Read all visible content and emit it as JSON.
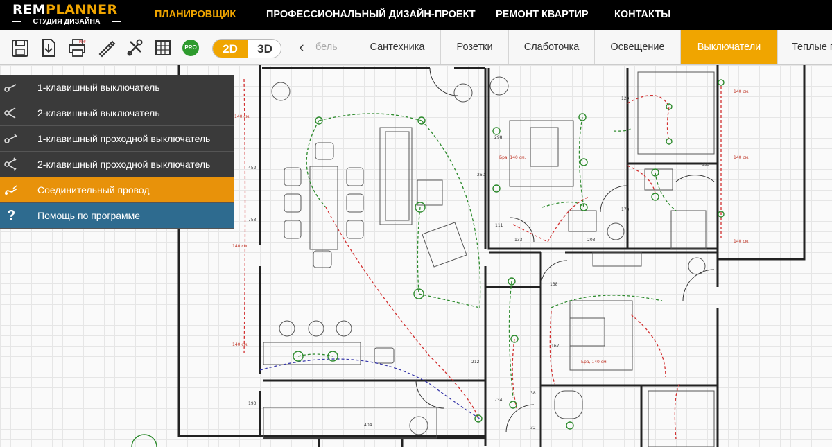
{
  "logo": {
    "brand_a": "REM",
    "brand_b": "PLANNER",
    "subtitle": "СТУДИЯ ДИЗАЙНА"
  },
  "nav": [
    {
      "label": "ПЛАНИРОВЩИК",
      "active": true
    },
    {
      "label": "ПРОФЕССИОНАЛЬНЫЙ ДИЗАЙН-ПРОЕКТ",
      "active": false
    },
    {
      "label": "РЕМОНТ КВАРТИР",
      "active": false
    },
    {
      "label": "КОНТАКТЫ",
      "active": false
    }
  ],
  "toolbar": {
    "tools": [
      "save-icon",
      "download-icon",
      "print-pdf-icon",
      "ruler-measure-icon",
      "tools-icon",
      "grid-settings-icon"
    ],
    "pro_label": "PRO",
    "view_2d": "2D",
    "view_3d": "3D",
    "active_view": "2D",
    "prev_arrow": "‹"
  },
  "categories": [
    {
      "label": "бель",
      "faded": true
    },
    {
      "label": "Сантехника"
    },
    {
      "label": "Розетки"
    },
    {
      "label": "Слаботочка"
    },
    {
      "label": "Освещение"
    },
    {
      "label": "Выключатели",
      "active": true
    },
    {
      "label": "Теплые п"
    }
  ],
  "sidemenu": [
    {
      "label": "1-клавишный выключатель",
      "icon": "single-switch-icon"
    },
    {
      "label": "2-клавишный выключатель",
      "icon": "double-switch-icon"
    },
    {
      "label": "1-клавишный проходной выключатель",
      "icon": "single-passthrough-switch-icon"
    },
    {
      "label": "2-клавишный проходной выключатель",
      "icon": "double-passthrough-switch-icon"
    },
    {
      "label": "Соединительный провод",
      "icon": "wire-icon",
      "style": "orange"
    },
    {
      "label": "Помощь по программе",
      "icon": "help-icon",
      "style": "blue",
      "glyph": "?"
    }
  ],
  "plan": {
    "dimensions": [
      "140 см.",
      "140 см.",
      "140 см.",
      "140 см.",
      "140 см.",
      "140 см.",
      "452",
      "753",
      "260",
      "212",
      "734",
      "298",
      "111",
      "133",
      "203",
      "178",
      "395",
      "120",
      "138",
      "167",
      "38",
      "32",
      "193",
      "404",
      "Бра, 140 см.",
      "Бра, 140 см."
    ],
    "colors": {
      "wall": "#222222",
      "green_wire": "#2e8b2e",
      "red_wire": "#d23030",
      "blue_wire": "#3a3aaa",
      "dim_red": "#c0392b"
    }
  }
}
